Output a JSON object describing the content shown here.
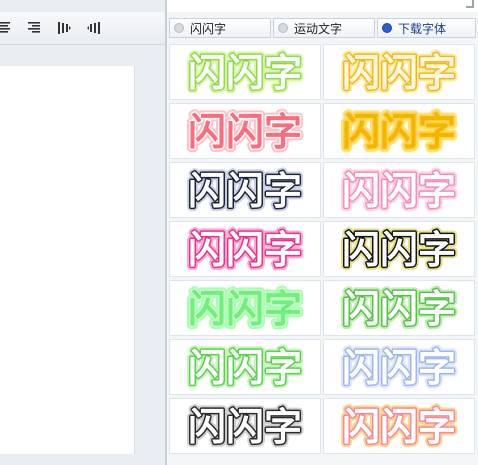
{
  "toolbar": {
    "buttons": [
      {
        "name": "align-center-icon"
      },
      {
        "name": "align-right-icon"
      },
      {
        "name": "text-direction-left-icon"
      },
      {
        "name": "text-direction-right-icon"
      }
    ]
  },
  "tabs": [
    {
      "label": "闪闪字",
      "active": false
    },
    {
      "label": "运动文字",
      "active": false
    },
    {
      "label": "下载字体",
      "active": true
    }
  ],
  "samples": [
    {
      "text": "闪闪字",
      "fill": "#ffffff",
      "stroke": "#8fd94b",
      "accent": "#d8f7a8"
    },
    {
      "text": "闪闪字",
      "fill": "#fff8dd",
      "stroke": "#f0b820",
      "accent": "#ffe9a0"
    },
    {
      "text": "闪闪字",
      "fill": "#ff6b7a",
      "stroke": "#ffffff",
      "accent": "#ffc1c8"
    },
    {
      "text": "闪闪字",
      "fill": "#f5b400",
      "stroke": "#ffd24a",
      "accent": "#ffe27a"
    },
    {
      "text": "闪闪字",
      "fill": "#ffffff",
      "stroke": "#1a2438",
      "accent": "#c9d0e6"
    },
    {
      "text": "闪闪字",
      "fill": "#ffffff",
      "stroke": "#f28dbb",
      "accent": "#ffd2e6"
    },
    {
      "text": "闪闪字",
      "fill": "#ffffff",
      "stroke": "#e2338f",
      "accent": "#ffa9d3"
    },
    {
      "text": "闪闪字",
      "fill": "#ffffff",
      "stroke": "#111111",
      "accent": "#e6e08a"
    },
    {
      "text": "闪闪字",
      "fill": "#6ef07a",
      "stroke": "#c9ffc9",
      "accent": "#a7ffb0"
    },
    {
      "text": "闪闪字",
      "fill": "#ffffff",
      "stroke": "#58c04a",
      "accent": "#c3efb5"
    },
    {
      "text": "闪闪字",
      "fill": "#ffffff",
      "stroke": "#5ad04e",
      "accent": "#c7f5bd"
    },
    {
      "text": "闪闪字",
      "fill": "#ffffff",
      "stroke": "#9fb6e8",
      "accent": "#dde6ff"
    },
    {
      "text": "闪闪字",
      "fill": "#ffffff",
      "stroke": "#2a2a2a",
      "accent": "#cfcfcf"
    },
    {
      "text": "闪闪字",
      "fill": "#ffffff",
      "stroke": "#f08a9c",
      "accent": "#ffd58f"
    }
  ]
}
